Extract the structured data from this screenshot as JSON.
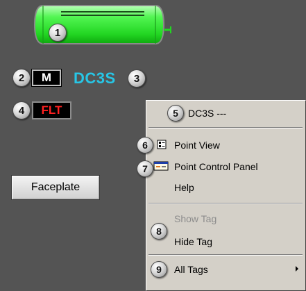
{
  "tank": {
    "callout": "1",
    "body_color": "#39e639"
  },
  "mode": {
    "callout": "2",
    "label": "M"
  },
  "tag": {
    "name": "DC3S",
    "callout": "3",
    "color": "#27c6e6"
  },
  "fault": {
    "callout": "4",
    "label": "FLT",
    "color": "#ff2020"
  },
  "faceplate": {
    "label": "Faceplate"
  },
  "menu": {
    "header": {
      "callout": "5",
      "label": "DC3S ---"
    },
    "point_view": {
      "callout": "6",
      "label": "Point View",
      "icon": "point-view-icon"
    },
    "point_control_panel": {
      "callout": "7",
      "label": "Point Control Panel",
      "icon": "control-panel-icon"
    },
    "help": {
      "label": "Help"
    },
    "show_tag": {
      "label": "Show Tag",
      "enabled": false
    },
    "tag_group_callout": "8",
    "hide_tag": {
      "label": "Hide Tag"
    },
    "all_tags": {
      "callout": "9",
      "label": "All Tags",
      "has_submenu": true
    }
  }
}
